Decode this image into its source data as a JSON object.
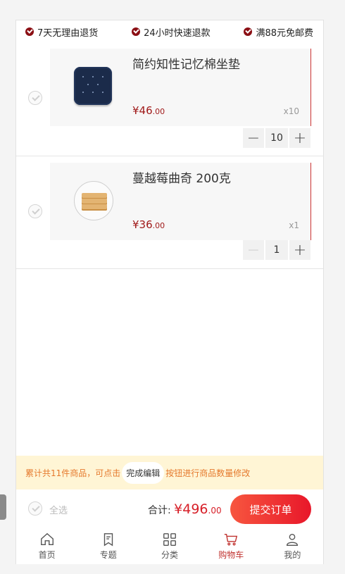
{
  "promo": [
    {
      "text": "7天无理由退货"
    },
    {
      "text": "24小时快速退款"
    },
    {
      "text": "满88元免邮费"
    }
  ],
  "cart": {
    "items": [
      {
        "name": "简约知性记忆棉坐垫",
        "price_main": "¥46",
        "price_dec": ".00",
        "qty_label": "x10",
        "qty": "10",
        "image": "cushion-image"
      },
      {
        "name": "蔓越莓曲奇 200克",
        "price_main": "¥36",
        "price_dec": ".00",
        "qty_label": "x1",
        "qty": "1",
        "image": "cookie-image"
      }
    ]
  },
  "notice": {
    "before": "累计共11件商品，可点击",
    "button": "完成编辑",
    "after": "按钮进行商品数量修改"
  },
  "footer": {
    "select_all": "全选",
    "total_label": "合计:",
    "total_main": "¥496",
    "total_dec": ".00",
    "submit": "提交订单"
  },
  "tabs": [
    {
      "label": "首页",
      "icon": "home-icon"
    },
    {
      "label": "专题",
      "icon": "bookmark-icon"
    },
    {
      "label": "分类",
      "icon": "grid-icon"
    },
    {
      "label": "购物车",
      "icon": "cart-icon",
      "active": true
    },
    {
      "label": "我的",
      "icon": "user-icon"
    }
  ],
  "colors": {
    "accent": "#d71f28",
    "promo_dot": "#8b0f14",
    "notice_bg": "#fff5d5",
    "notice_text": "#e5792c"
  }
}
